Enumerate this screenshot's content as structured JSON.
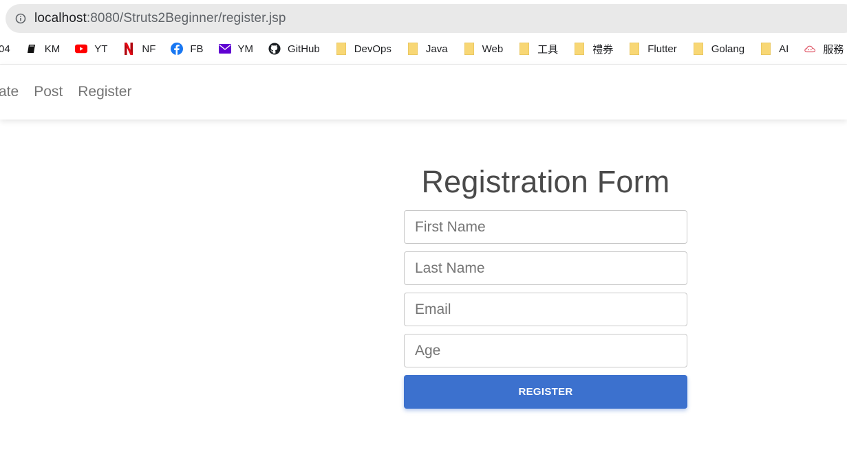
{
  "browser": {
    "url_host": "localhost",
    "url_path": ":8080/Struts2Beginner/register.jsp"
  },
  "bookmarks": [
    {
      "label": "04",
      "icon": "none"
    },
    {
      "label": "KM",
      "icon": "book-icon"
    },
    {
      "label": "YT",
      "icon": "youtube-icon"
    },
    {
      "label": "NF",
      "icon": "netflix-icon"
    },
    {
      "label": "FB",
      "icon": "facebook-icon"
    },
    {
      "label": "YM",
      "icon": "mail-icon"
    },
    {
      "label": "GitHub",
      "icon": "github-icon"
    },
    {
      "label": "DevOps",
      "icon": "folder-icon"
    },
    {
      "label": "Java",
      "icon": "folder-icon"
    },
    {
      "label": "Web",
      "icon": "folder-icon"
    },
    {
      "label": "工具",
      "icon": "folder-icon"
    },
    {
      "label": "禮券",
      "icon": "folder-icon"
    },
    {
      "label": "Flutter",
      "icon": "folder-icon"
    },
    {
      "label": "Golang",
      "icon": "folder-icon"
    },
    {
      "label": "AI",
      "icon": "folder-icon"
    },
    {
      "label": "服務",
      "icon": "cloud-icon"
    }
  ],
  "colors": {
    "folder": "#f8d775",
    "youtube": "#ff0000",
    "netflix": "#e50914",
    "facebook": "#1877f2",
    "mail": "#6001d2",
    "accent_button": "#3c71ce"
  },
  "nav": {
    "links": [
      "ate",
      "Post",
      "Register"
    ]
  },
  "form": {
    "title": "Registration Form",
    "first_name_placeholder": "First Name",
    "last_name_placeholder": "Last Name",
    "email_placeholder": "Email",
    "age_placeholder": "Age",
    "submit_label": "REGISTER"
  }
}
